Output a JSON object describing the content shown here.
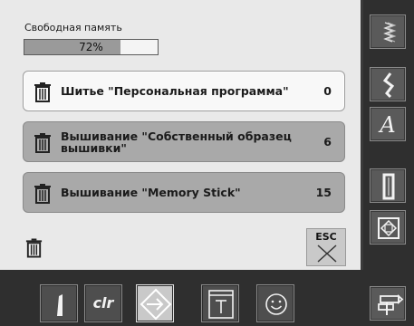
{
  "memory": {
    "label": "Свободная память",
    "percent_text": "72%",
    "free_fraction": 0.72
  },
  "items": [
    {
      "label": "Шитье \"Персональная программа\"",
      "count": "0",
      "style": "white"
    },
    {
      "label": "Вышивание \"Собственный образец вышивки\"",
      "count": "6",
      "style": "grey"
    },
    {
      "label": "Вышивание \"Memory Stick\"",
      "count": "15",
      "style": "grey"
    }
  ],
  "esc": {
    "label": "ESC"
  },
  "right_toolbar": [
    {
      "icon": "zigzag-stitch-icon"
    },
    {
      "icon": "practical-stitch-icon"
    },
    {
      "icon": "alphabet-icon",
      "glyph": "A"
    },
    {
      "icon": "buttonhole-icon"
    },
    {
      "icon": "quilt-icon"
    },
    {
      "icon": "setup-signpost-icon"
    }
  ],
  "bottom_toolbar": [
    {
      "icon": "needle-position-icon"
    },
    {
      "icon": "clr-icon",
      "glyph": "clr"
    },
    {
      "icon": "memory-icon",
      "selected": true
    },
    {
      "icon": "tutorial-icon"
    },
    {
      "icon": "smiley-icon"
    }
  ]
}
